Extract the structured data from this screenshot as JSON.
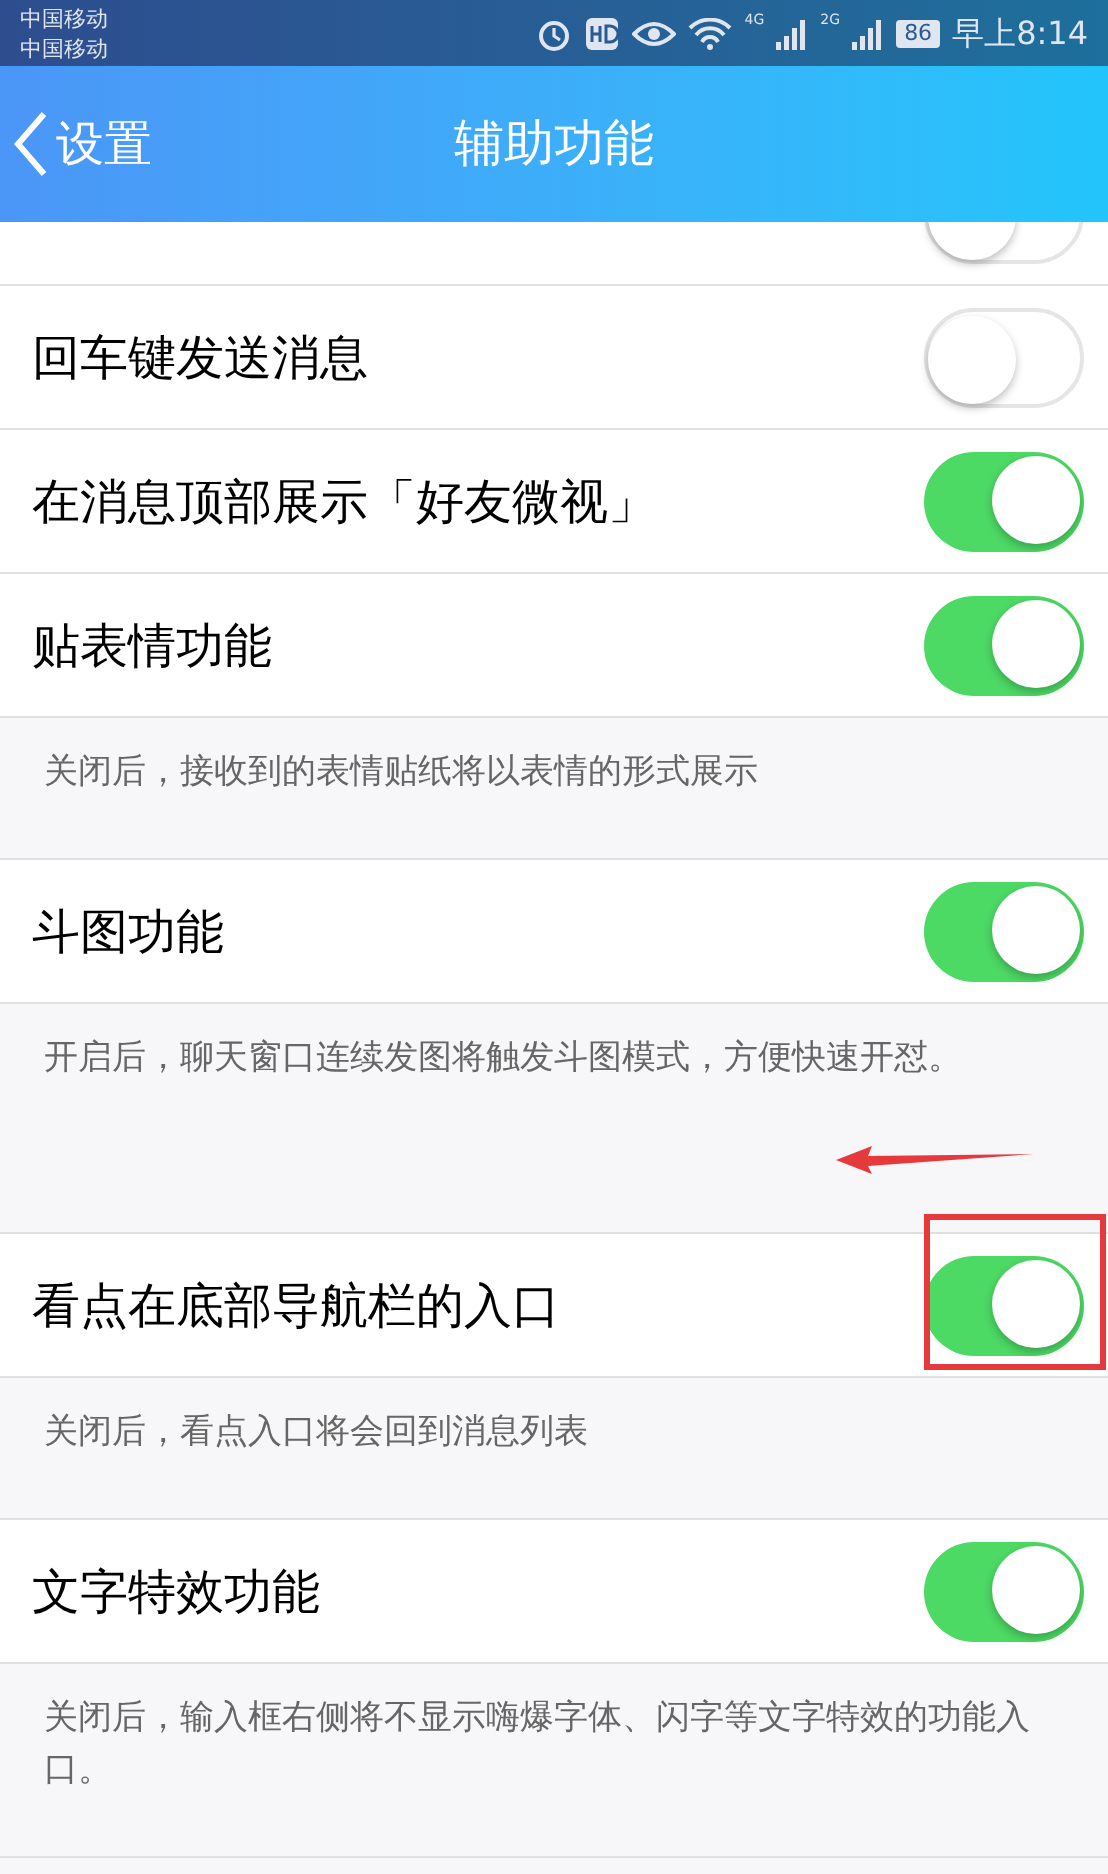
{
  "status_bar": {
    "carriers": [
      "中国移动",
      "中国移动"
    ],
    "network_1": "4G",
    "network_2": "2G",
    "battery": "86",
    "time": "早上8:14"
  },
  "header": {
    "back_label": "设置",
    "title": "辅助功能"
  },
  "items": [
    {
      "kind": "cut_toggle",
      "on": false
    },
    {
      "kind": "toggle",
      "label": "回车键发送消息",
      "on": false
    },
    {
      "kind": "toggle",
      "label": "在消息顶部展示「好友微视」",
      "on": true
    },
    {
      "kind": "toggle",
      "label": "贴表情功能",
      "on": true
    },
    {
      "kind": "note",
      "text": "关闭后，接收到的表情贴纸将以表情的形式展示"
    },
    {
      "kind": "toggle",
      "label": "斗图功能",
      "on": true
    },
    {
      "kind": "note",
      "text": "开启后，聊天窗口连续发图将触发斗图模式，方便快速开怼。",
      "arrow": true
    },
    {
      "kind": "toggle",
      "label": "看点在底部导航栏的入口",
      "on": true,
      "highlighted": true
    },
    {
      "kind": "note",
      "text": "关闭后，看点入口将会回到消息列表"
    },
    {
      "kind": "toggle",
      "label": "文字特效功能",
      "on": true
    },
    {
      "kind": "note",
      "text": "关闭后，输入框右侧将不显示嗨爆字体、闪字等文字特效的功能入口。"
    }
  ]
}
